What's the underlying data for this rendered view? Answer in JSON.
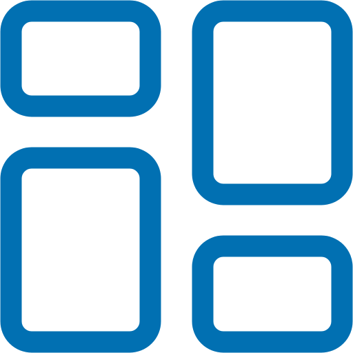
{
  "icon": {
    "name": "dashboard-layout-icon",
    "style": "outline",
    "color": "#0170b2",
    "background": "#ffffff",
    "panels": [
      {
        "name": "top-left-panel"
      },
      {
        "name": "top-right-panel"
      },
      {
        "name": "bottom-left-panel"
      },
      {
        "name": "bottom-right-panel"
      }
    ]
  }
}
